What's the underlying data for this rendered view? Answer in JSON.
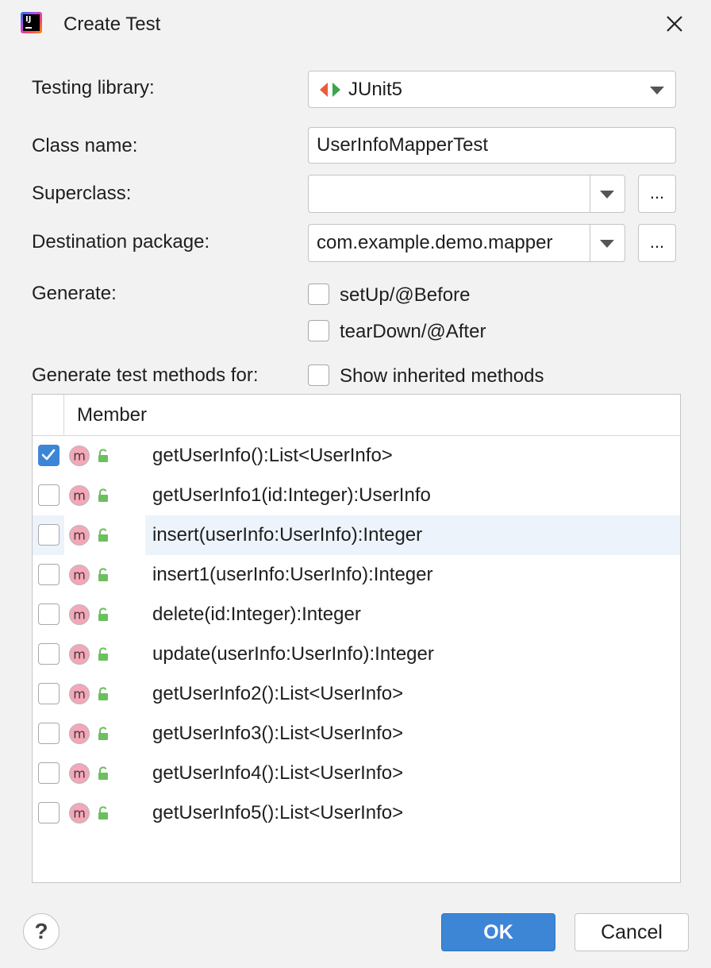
{
  "window": {
    "title": "Create Test"
  },
  "form": {
    "testing_library_label": "Testing library:",
    "testing_library_value": "JUnit5",
    "class_name_label": "Class name:",
    "class_name_value": "UserInfoMapperTest",
    "superclass_label": "Superclass:",
    "superclass_value": "",
    "destination_label": "Destination package:",
    "destination_value": "com.example.demo.mapper",
    "browse_label": "...",
    "generate_label": "Generate:",
    "setup_label": "setUp/@Before",
    "setup_checked": false,
    "teardown_label": "tearDown/@After",
    "teardown_checked": false,
    "methods_for_label": "Generate test methods for:",
    "show_inherited_label": "Show inherited methods",
    "show_inherited_checked": false
  },
  "table": {
    "header": "Member",
    "rows": [
      {
        "text": "getUserInfo():List<UserInfo>",
        "checked": true
      },
      {
        "text": "getUserInfo1(id:Integer):UserInfo",
        "checked": false
      },
      {
        "text": "insert(userInfo:UserInfo):Integer",
        "checked": false
      },
      {
        "text": "insert1(userInfo:UserInfo):Integer",
        "checked": false
      },
      {
        "text": "delete(id:Integer):Integer",
        "checked": false
      },
      {
        "text": "update(userInfo:UserInfo):Integer",
        "checked": false
      },
      {
        "text": "getUserInfo2():List<UserInfo>",
        "checked": false
      },
      {
        "text": "getUserInfo3():List<UserInfo>",
        "checked": false
      },
      {
        "text": "getUserInfo4():List<UserInfo>",
        "checked": false
      },
      {
        "text": "getUserInfo5():List<UserInfo>",
        "checked": false
      }
    ]
  },
  "footer": {
    "help_label": "?",
    "ok_label": "OK",
    "cancel_label": "Cancel"
  },
  "colors": {
    "accent": "#3d86d6",
    "hover_row": "#edf3fb",
    "method_icon": "#f4a7b9",
    "lock_icon": "#6cbf5e"
  },
  "icons": {
    "app": "intellij-icon",
    "junit": "junit-icon",
    "method": "method-icon",
    "visibility": "public-lock-icon"
  }
}
